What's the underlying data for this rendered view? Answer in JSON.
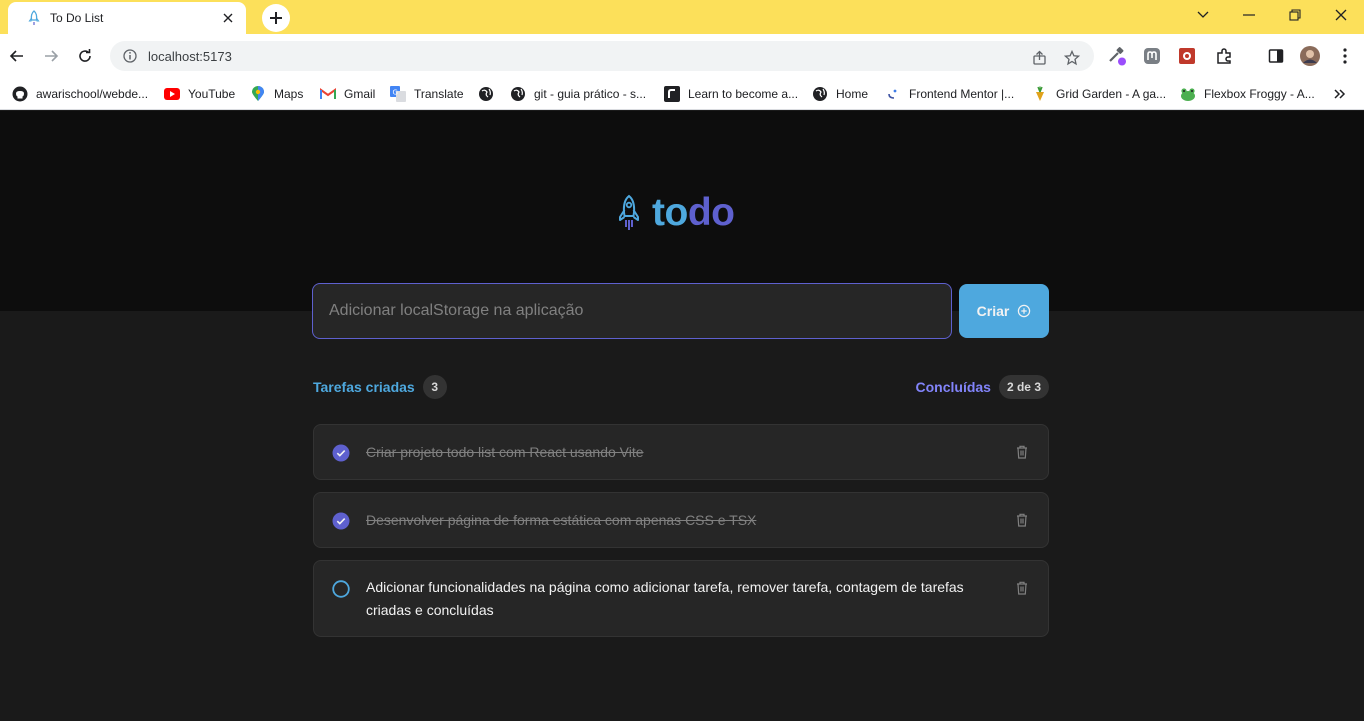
{
  "browser": {
    "tab": {
      "title": "To Do List"
    },
    "address_bar": {
      "url": "localhost:5173"
    },
    "bookmarks": [
      {
        "label": "awarischool/webde...",
        "icon": "github-icon"
      },
      {
        "label": "YouTube",
        "icon": "youtube-icon"
      },
      {
        "label": "Maps",
        "icon": "maps-icon"
      },
      {
        "label": "Gmail",
        "icon": "gmail-icon"
      },
      {
        "label": "Translate",
        "icon": "translate-icon"
      },
      {
        "label": "",
        "icon": "globe-icon"
      },
      {
        "label": "git - guia prático - s...",
        "icon": "globe-icon"
      },
      {
        "label": "Learn to become a...",
        "icon": "roadmap-icon"
      },
      {
        "label": "Home",
        "icon": "globe-icon"
      },
      {
        "label": "Frontend Mentor |...",
        "icon": "frontend-mentor-icon"
      },
      {
        "label": "Grid Garden - A ga...",
        "icon": "carrot-icon"
      },
      {
        "label": "Flexbox Froggy - A...",
        "icon": "frog-icon"
      }
    ]
  },
  "app": {
    "logo": {
      "part1": "to",
      "part2": "do"
    },
    "new_task": {
      "value": "Adicionar localStorage na aplicação"
    },
    "create_button": {
      "label": "Criar"
    },
    "created": {
      "label": "Tarefas criadas",
      "count": "3"
    },
    "completed": {
      "label": "Concluídas",
      "count": "2 de 3"
    },
    "tasks": [
      {
        "text": "Criar projeto todo list com React usando Vite",
        "done": true
      },
      {
        "text": "Desenvolver página de forma estática com apenas CSS e TSX",
        "done": true
      },
      {
        "text": "Adicionar funcionalidades na página como adicionar tarefa, remover tarefa, contagem de tarefas criadas e concluídas",
        "done": false
      }
    ]
  },
  "colors": {
    "blue": "#4ea8de",
    "purple": "#5e60ce",
    "tab_strip": "#fce05a"
  }
}
